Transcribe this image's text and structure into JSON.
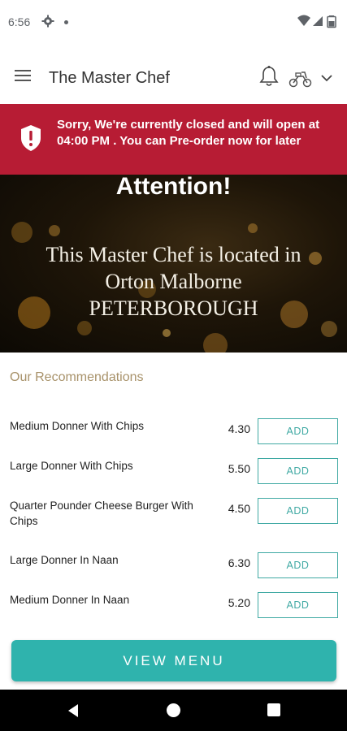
{
  "status_bar": {
    "time": "6:56",
    "icons": [
      "gear-icon",
      "dot-icon",
      "wifi-icon",
      "signal-icon",
      "battery-icon"
    ]
  },
  "app_bar": {
    "title": "The Master Chef",
    "icons": [
      "menu-icon",
      "bell-icon",
      "scooter-icon",
      "chevron-down-icon"
    ]
  },
  "alert": {
    "text": "Sorry, We're currently closed and will open at 04:00 PM . You can Pre-order now for later",
    "color": "#b71c34"
  },
  "hero": {
    "title": "Attention!",
    "line1": "This Master Chef is located in",
    "line2": "Orton Malborne",
    "line3": "PETERBOROUGH"
  },
  "recommendations": {
    "heading": "Our Recommendations",
    "add_label": "ADD",
    "items": [
      {
        "name": "Medium Donner With Chips",
        "price": "4.30"
      },
      {
        "name": "Large Donner With Chips",
        "price": "5.50"
      },
      {
        "name": "Quarter Pounder Cheese Burger With Chips",
        "price": "4.50"
      },
      {
        "name": "Large Donner In Naan",
        "price": "6.30"
      },
      {
        "name": "Medium  Donner In Naan",
        "price": "5.20"
      }
    ]
  },
  "view_menu": {
    "label": "VIEW MENU"
  },
  "colors": {
    "accent": "#2fb3ad",
    "heading": "#a8926a",
    "alert": "#b71c34"
  }
}
